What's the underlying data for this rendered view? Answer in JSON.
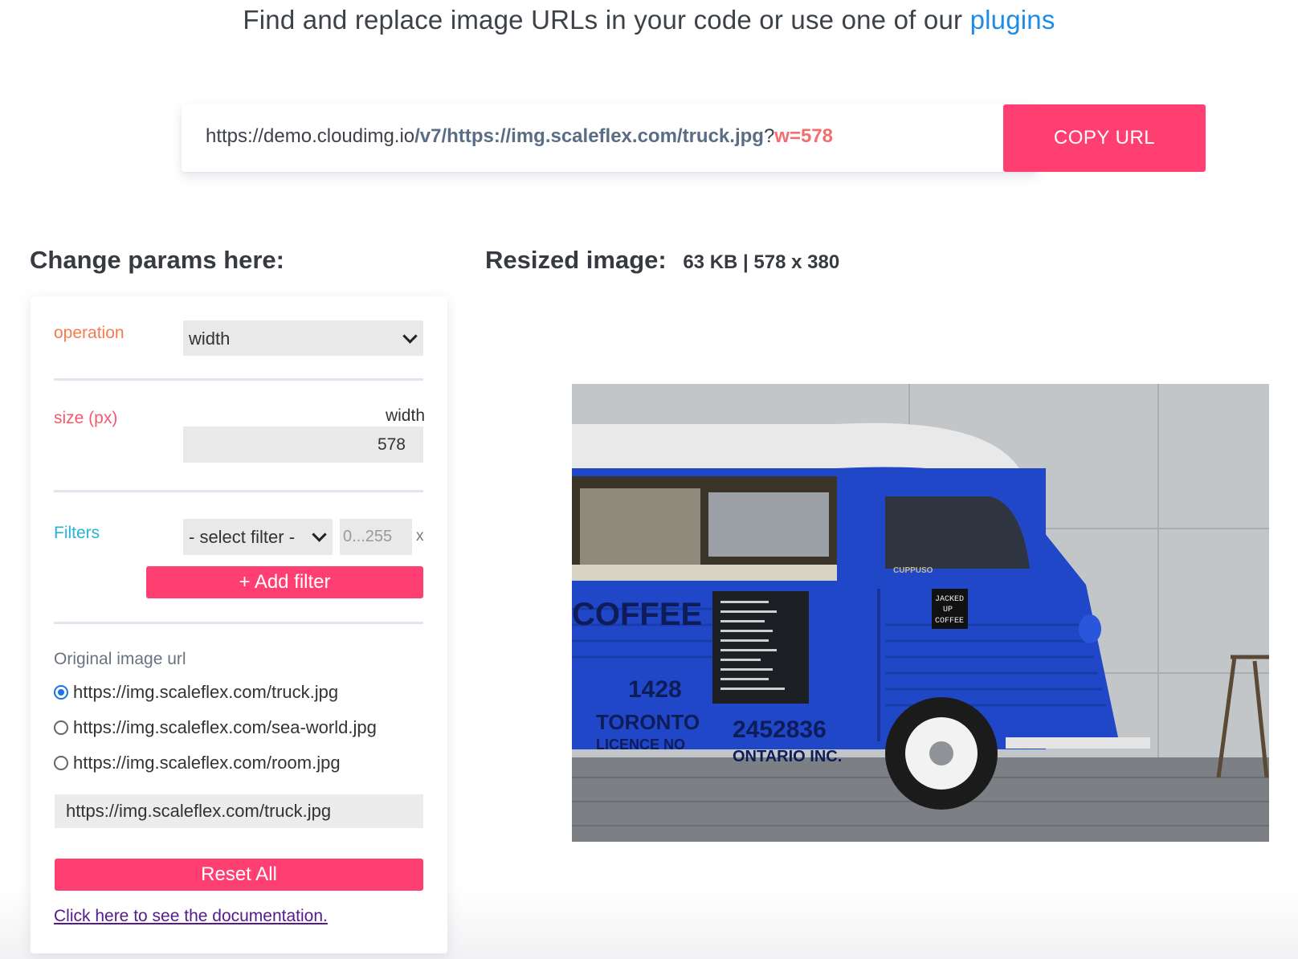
{
  "header": {
    "headline_text": "Find and replace image URLs in your code or use one of our",
    "headline_link": "plugins"
  },
  "url_bar": {
    "base": "https://demo.cloudimg.io",
    "path": "/v7/https://img.scaleflex.com/truck.jpg",
    "query_sep": "?",
    "query": "w=578",
    "copy_label": "COPY URL"
  },
  "params": {
    "title": "Change params here:",
    "operation_label": "operation",
    "operation_value": "width",
    "size_label": "size (px)",
    "size_sublabel": "width",
    "size_value": "578",
    "filters_label": "Filters",
    "filter_select_value": "- select filter -",
    "filter_value_placeholder": "0...255",
    "filter_remove": "x",
    "add_filter_label": "+ Add filter",
    "original_url_label": "Original image url",
    "url_options": [
      {
        "label": "https://img.scaleflex.com/truck.jpg",
        "selected": true
      },
      {
        "label": "https://img.scaleflex.com/sea-world.jpg",
        "selected": false
      },
      {
        "label": "https://img.scaleflex.com/room.jpg",
        "selected": false
      }
    ],
    "url_input_value": "https://img.scaleflex.com/truck.jpg",
    "reset_label": "Reset All",
    "doc_link": "Click here to see the documentation."
  },
  "result": {
    "title": "Resized image:",
    "meta": "63 KB | 578 x 380",
    "truck_text": {
      "coffee": "COFFEE",
      "phone": "2452836",
      "company": "ONTARIO INC.",
      "plate_num": "1428",
      "city": "TORONTO",
      "licence": "LICENCE NO",
      "sign_1": "JACKED",
      "sign_2": "UP",
      "sign_3": "COFFEE",
      "brand": "CUPPUSO"
    }
  },
  "colors": {
    "accent": "#ff3f71",
    "link": "#1e8be6",
    "truck_blue": "#1f47c8"
  }
}
